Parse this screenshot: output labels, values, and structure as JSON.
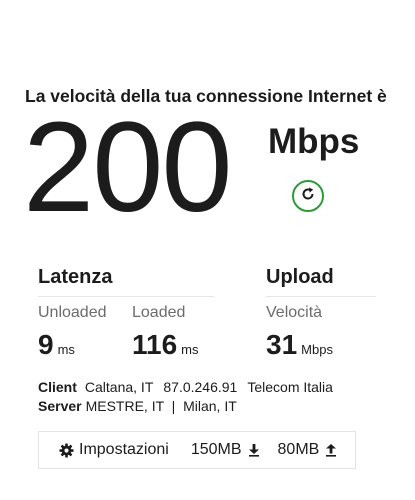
{
  "header": {
    "headline": "La velocità della tua connessione Internet è",
    "speed_value": "200",
    "speed_unit": "Mbps"
  },
  "latency": {
    "title": "Latenza",
    "unloaded_label": "Unloaded",
    "unloaded_value": "9",
    "unloaded_unit": "ms",
    "loaded_label": "Loaded",
    "loaded_value": "116",
    "loaded_unit": "ms"
  },
  "upload": {
    "title": "Upload",
    "speed_label": "Velocità",
    "speed_value": "31",
    "speed_unit": "Mbps"
  },
  "client": {
    "label": "Client",
    "location": "Caltana, IT",
    "ip": "87.0.246.91",
    "isp": "Telecom Italia"
  },
  "server": {
    "label": "Server",
    "locations": "MESTRE, IT  |  Milan, IT"
  },
  "settings": {
    "label": "Impostazioni",
    "download_size": "150MB",
    "upload_size": "80MB"
  },
  "colors": {
    "accent": "#2e9b3a"
  },
  "icons": {
    "refresh": "refresh-icon",
    "settings": "gear-icon",
    "download": "download-arrow-icon",
    "upload": "upload-arrow-icon"
  }
}
